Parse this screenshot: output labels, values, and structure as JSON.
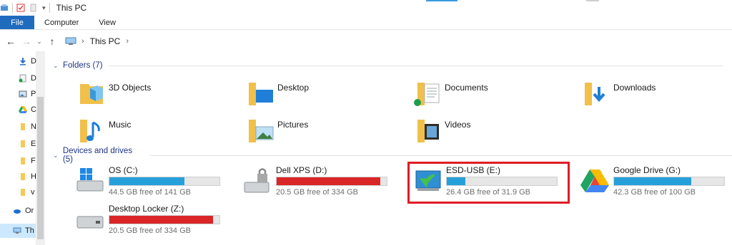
{
  "window": {
    "title": "This PC"
  },
  "ribbon": {
    "tabs": [
      "File",
      "Computer",
      "View"
    ]
  },
  "address": {
    "crumbs": [
      "This PC"
    ]
  },
  "navpane": {
    "items": [
      {
        "label": "D",
        "icon": "download-arrow-icon"
      },
      {
        "label": "D",
        "icon": "documents-icon"
      },
      {
        "label": "P",
        "icon": "pictures-icon"
      },
      {
        "label": "C",
        "icon": "google-drive-icon"
      },
      {
        "label": "N",
        "icon": "folder-icon"
      },
      {
        "label": "E",
        "icon": "folder-icon"
      },
      {
        "label": "F",
        "icon": "folder-icon"
      },
      {
        "label": "H",
        "icon": "folder-icon"
      },
      {
        "label": "v",
        "icon": "folder-icon"
      },
      {
        "label": "Or",
        "icon": "onedrive-cloud-icon"
      },
      {
        "label": "Th",
        "icon": "this-pc-icon"
      }
    ]
  },
  "folders": {
    "header": "Folders (7)",
    "items": [
      {
        "label": "3D Objects",
        "icon": "3d-objects-folder-icon"
      },
      {
        "label": "Desktop",
        "icon": "desktop-folder-icon"
      },
      {
        "label": "Documents",
        "icon": "documents-folder-icon"
      },
      {
        "label": "Downloads",
        "icon": "downloads-folder-icon"
      },
      {
        "label": "Music",
        "icon": "music-folder-icon"
      },
      {
        "label": "Pictures",
        "icon": "pictures-folder-icon"
      },
      {
        "label": "Videos",
        "icon": "videos-folder-icon"
      }
    ]
  },
  "drives": {
    "header": "Devices and drives (5)",
    "items": [
      {
        "name": "OS (C:)",
        "free": "44.5 GB free of 141 GB",
        "used_fraction": 0.68,
        "color": "#26a0da",
        "icon": "windows-drive-icon"
      },
      {
        "name": "Dell XPS (D:)",
        "free": "20.5 GB free of 334 GB",
        "used_fraction": 0.94,
        "color": "#da2626",
        "icon": "locked-drive-icon"
      },
      {
        "name": "ESD-USB (E:)",
        "free": "26.4 GB free of 31.9 GB",
        "used_fraction": 0.17,
        "color": "#26a0da",
        "icon": "usb-drive-icon"
      },
      {
        "name": "Google Drive (G:)",
        "free": "42.3 GB free of 100 GB",
        "used_fraction": 0.7,
        "color": "#26a0da",
        "icon": "google-drive-icon"
      },
      {
        "name": "Desktop Locker (Z:)",
        "free": "20.5 GB free of 334 GB",
        "used_fraction": 0.94,
        "color": "#da2626",
        "icon": "network-drive-icon"
      }
    ]
  }
}
